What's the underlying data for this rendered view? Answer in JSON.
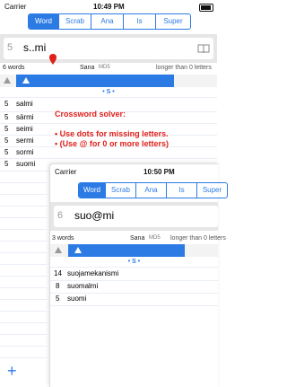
{
  "back": {
    "status": {
      "carrier": "Carrier",
      "time": "10:49 PM"
    },
    "segments": [
      "Word",
      "Scrab",
      "Ana",
      "Is",
      "Super"
    ],
    "active_segment": 0,
    "search": {
      "count": "5",
      "value": "s..mi"
    },
    "info": {
      "words": "6 words",
      "dict": "Sana",
      "md5": "MD5",
      "filter": "longer than 0 letters"
    },
    "section": "• S •",
    "words": [
      {
        "n": "5",
        "w": "salmi"
      },
      {
        "n": "5",
        "w": "särmi"
      },
      {
        "n": "5",
        "w": "seimi"
      },
      {
        "n": "5",
        "w": "sermi"
      },
      {
        "n": "5",
        "w": "sormi"
      },
      {
        "n": "5",
        "w": "suomi"
      }
    ],
    "help": {
      "title": "Crossword solver:",
      "line1": "• Use dots for missing letters.",
      "line2": "• (Use @ for 0 or more letters)"
    },
    "add": "+"
  },
  "front": {
    "status": {
      "carrier": "Carrier",
      "time": "10:50 PM"
    },
    "segments": [
      "Word",
      "Scrab",
      "Ana",
      "Is",
      "Super"
    ],
    "active_segment": 0,
    "search": {
      "count": "6",
      "value": "suo@mi"
    },
    "info": {
      "words": "3 words",
      "dict": "Sana",
      "md5": "MD5",
      "filter": "longer than 0 letters"
    },
    "section": "• S •",
    "words": [
      {
        "n": "14",
        "w": "suojamekanismi"
      },
      {
        "n": "8",
        "w": "suomalmi"
      },
      {
        "n": "5",
        "w": "suomi"
      }
    ]
  },
  "colors": {
    "accent": "#2c7be5",
    "help_text": "#e0211b"
  }
}
